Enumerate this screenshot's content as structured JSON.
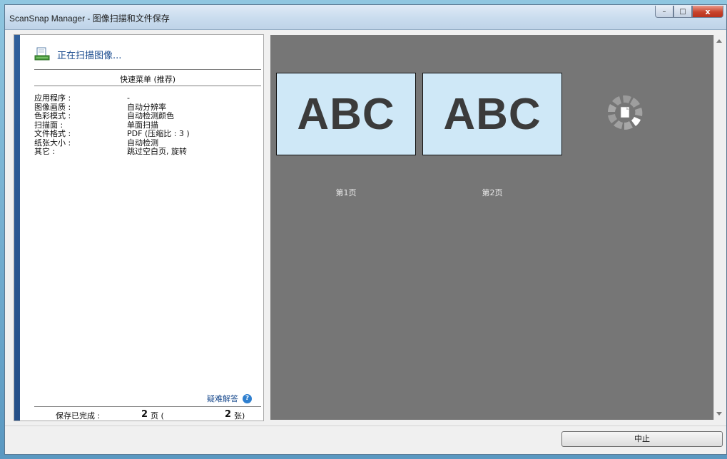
{
  "window": {
    "title": "ScanSnap Manager - 图像扫描和文件保存",
    "controls": {
      "minimize": "–",
      "maximize": "□",
      "close": "x"
    }
  },
  "left": {
    "status_text": "正在扫描图像...",
    "menu_title": "快速菜单 (推荐)",
    "settings": [
      {
        "label": "应用程序 :",
        "value": "-"
      },
      {
        "label": "图像画质 :",
        "value": "自动分辨率"
      },
      {
        "label": "色彩模式 :",
        "value": "自动检测颜色"
      },
      {
        "label": "扫描面 :",
        "value": "单面扫描"
      },
      {
        "label": "文件格式 :",
        "value": "PDF (压缩比 : 3 )"
      },
      {
        "label": "纸张大小 :",
        "value": "自动检测"
      },
      {
        "label": "其它 :",
        "value": "跳过空白页, 旋转"
      }
    ],
    "help_link": "疑难解答",
    "help_icon": "?",
    "footer": {
      "label": "保存已完成 :",
      "pages_num": "2",
      "pages_unit": "页 (",
      "sheets_num": "2",
      "sheets_unit": "张)"
    }
  },
  "preview": {
    "pages": [
      {
        "image_text": "ABC",
        "label": "第1页"
      },
      {
        "image_text": "ABC",
        "label": "第2页"
      }
    ],
    "spinner_icon": "loading-spinner-icon"
  },
  "buttons": {
    "stop": "中止"
  },
  "colors": {
    "accent_bar": "#2f5f9b",
    "link": "#1b4c8f",
    "preview_bg": "#767676",
    "thumb_bg": "#cfe8f7"
  }
}
